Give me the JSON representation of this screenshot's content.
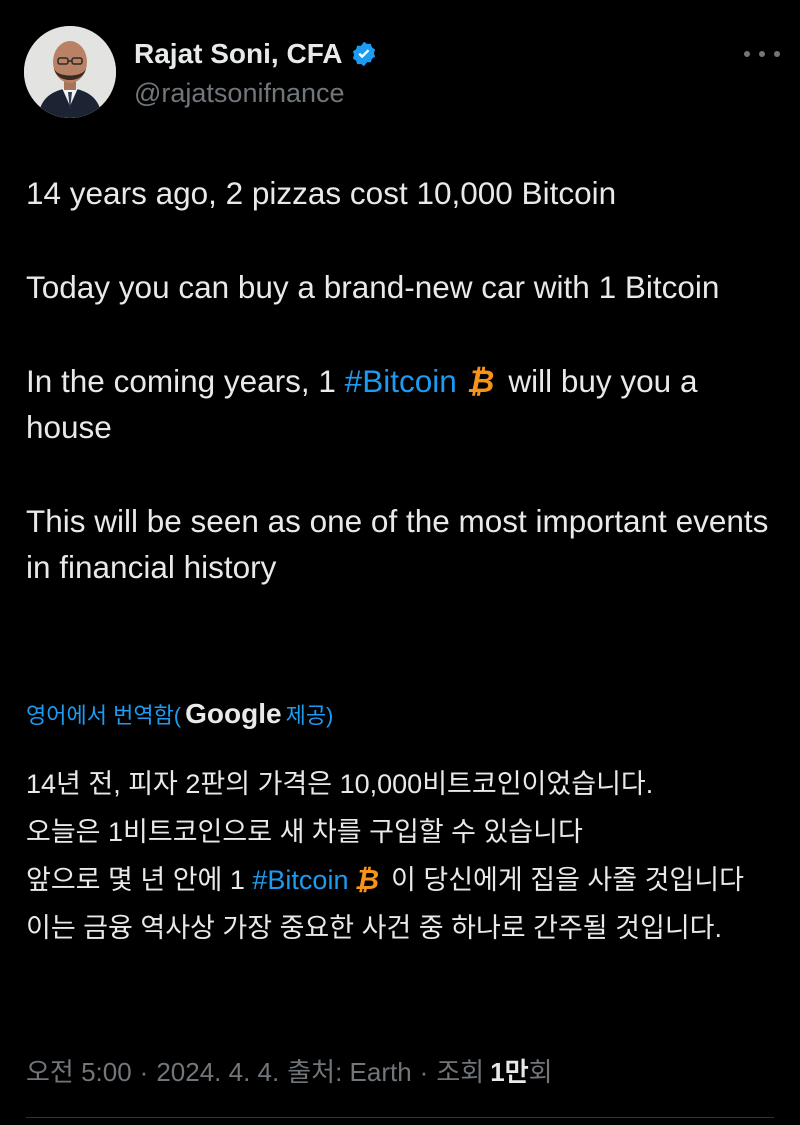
{
  "author": {
    "name": "Rajat Soni, CFA",
    "handle": "@rajatsonifnance"
  },
  "tweet": {
    "p1": "14 years ago, 2 pizzas cost 10,000 Bitcoin",
    "p2": "Today you can buy a brand-new car with 1 Bitcoin",
    "p3_before": "In the coming years, 1 ",
    "p3_hashtag": "#Bitcoin",
    "p3_after": "will buy you a house",
    "p4": "This will be seen as one of the most important events in financial history"
  },
  "translation": {
    "label_before": "영어에서 번역함(",
    "provider": "Google",
    "label_after": " 제공)",
    "line1": "14년 전, 피자 2판의 가격은 10,000비트코인이었습니다.",
    "line2": "오늘은 1비트코인으로 새 차를 구입할 수 있습니다",
    "line3_before": "앞으로 몇 년 안에 1 ",
    "line3_hashtag": "#Bitcoin",
    "line3_after": "이 당신에게 집을 사줄 것입니다",
    "line4": "이는 금융 역사상 가장 중요한 사건 중 하나로 간주될 것입니다."
  },
  "meta": {
    "time": "오전 5:00",
    "date": "2024. 4. 4.",
    "source": "출처: Earth",
    "views_label": "조회",
    "views_count_bold": "1만",
    "views_suffix": "회"
  },
  "icons": {
    "bitcoin_symbol": "₿",
    "colors": {
      "accent": "#1d9bf0",
      "bitcoin": "#f7931a",
      "muted": "#71767b",
      "text": "#e7e9ea"
    }
  }
}
